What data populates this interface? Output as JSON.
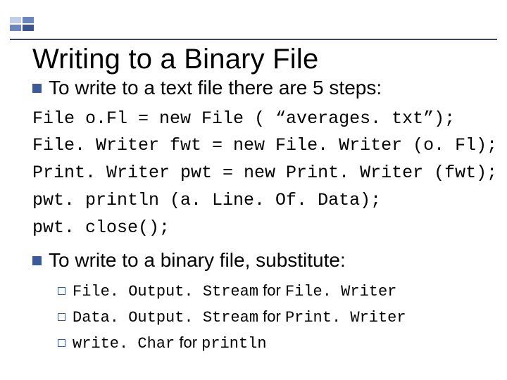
{
  "title": "Writing to a Binary File",
  "bullet1": "To write to a text file there are 5 steps:",
  "code": {
    "l1": "File o.Fl = new File ( “averages. txt”);",
    "l2": "File. Writer fwt = new File. Writer (o. Fl);",
    "l3": "Print. Writer pwt = new Print. Writer (fwt);",
    "l4": "pwt. println (a. Line. Of. Data);",
    "l5": "pwt. close();"
  },
  "bullet2": "To write to a binary file, substitute:",
  "subs": {
    "a": {
      "left": "File. Output. Stream",
      "mid": " for ",
      "right": "File. Writer"
    },
    "b": {
      "left": "Data. Output. Stream",
      "mid": " for ",
      "right": "Print. Writer"
    },
    "c": {
      "left": "write. Char",
      "mid": " for ",
      "right": "println"
    }
  }
}
